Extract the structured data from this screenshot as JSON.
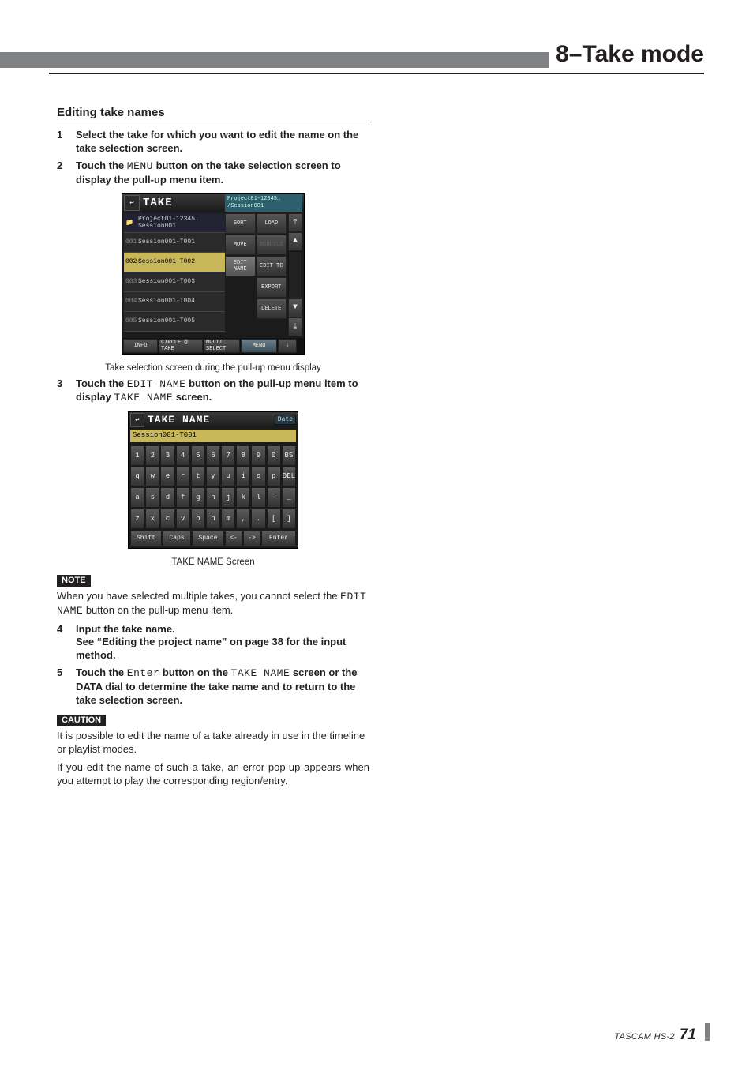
{
  "header": {
    "chapter_title": "8–Take mode"
  },
  "section": {
    "heading": "Editing take names"
  },
  "steps": {
    "s1": {
      "num": "1",
      "text": "Select the take for which you want to edit the name on the take selection screen."
    },
    "s2": {
      "num": "2",
      "pre": "Touch the ",
      "btn": "MENU",
      "post": " button on the take selection screen to display the pull-up menu item."
    },
    "s3": {
      "num": "3",
      "pre": "Touch the ",
      "btn": "EDIT NAME",
      "mid": " button on the pull-up menu item to display ",
      "btn2": "TAKE NAME",
      "post": " screen."
    },
    "s4": {
      "num": "4",
      "bold": "Input the take name.",
      "body": "See “Editing the project name” on page 38 for the input method."
    },
    "s5": {
      "num": "5",
      "pre": "Touch the ",
      "btn": "Enter",
      "mid": " button on the ",
      "btn2": "TAKE NAME",
      "post": " screen or the DATA dial to determine the take name and to return to the take selection screen."
    }
  },
  "captions": {
    "fig1": "Take selection screen during the pull-up menu display",
    "fig2": "TAKE NAME Screen"
  },
  "note": {
    "label": "NOTE",
    "pre": "When you have selected multiple takes, you cannot select the ",
    "btn": "EDIT NAME",
    "post": " button on the pull-up menu item."
  },
  "caution": {
    "label": "CAUTION",
    "p1": "It is possible to edit the name of a take already in use in the timeline or playlist modes.",
    "p2": "If you edit the name of such a take, an error pop-up appears when you attempt to play the corresponding region/entry."
  },
  "footer": {
    "model": "TASCAM HS-2",
    "page": "71"
  },
  "fig1": {
    "title": "TAKE",
    "crumb1": "Project01-12345…",
    "crumb2": "/Session001",
    "row0_a": "Project01-12345…",
    "row0_b": "Session001",
    "rows": [
      {
        "idx": "001",
        "txt": "Session001-T001"
      },
      {
        "idx": "002",
        "txt": "Session001-T002"
      },
      {
        "idx": "003",
        "txt": "Session001-T003"
      },
      {
        "idx": "004",
        "txt": "Session001-T004"
      },
      {
        "idx": "005",
        "txt": "Session001-T005"
      }
    ],
    "menu": {
      "sort": "SORT",
      "load": "LOAD",
      "move": "MOVE",
      "rebuild": "REBUILD",
      "editname": "EDIT NAME",
      "edittc": "EDIT TC",
      "export": "EXPORT",
      "delete": "DELETE"
    },
    "bottom": {
      "info": "INFO",
      "circle": "CIRCLE @ TAKE",
      "multi": "MULTI SELECT",
      "menu": "MENU"
    }
  },
  "fig2": {
    "title": "TAKE NAME",
    "date": "Date",
    "field": "Session001-T001",
    "rows": [
      [
        "1",
        "2",
        "3",
        "4",
        "5",
        "6",
        "7",
        "8",
        "9",
        "0",
        "BS"
      ],
      [
        "q",
        "w",
        "e",
        "r",
        "t",
        "y",
        "u",
        "i",
        "o",
        "p",
        "DEL"
      ],
      [
        "a",
        "s",
        "d",
        "f",
        "g",
        "h",
        "j",
        "k",
        "l",
        "-",
        "_"
      ],
      [
        "z",
        "x",
        "c",
        "v",
        "b",
        "n",
        "m",
        ",",
        ".",
        "[",
        "]"
      ]
    ],
    "bottom": {
      "shift": "Shift",
      "caps": "Caps",
      "space": "Space",
      "left": "<-",
      "right": "->",
      "enter": "Enter"
    }
  }
}
